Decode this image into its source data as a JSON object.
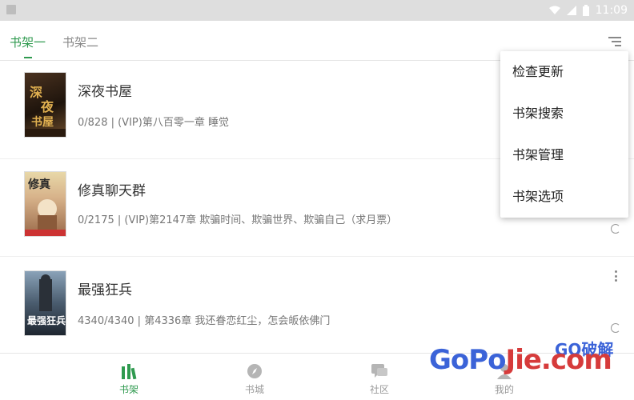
{
  "status_bar": {
    "time": "11:09"
  },
  "tabs": [
    {
      "label": "书架一",
      "active": true
    },
    {
      "label": "书架二",
      "active": false
    }
  ],
  "books": [
    {
      "title": "深夜书屋",
      "meta": "0/828 | (VIP)第八百零一章 睡觉"
    },
    {
      "title": "修真聊天群",
      "meta": "0/2175 | (VIP)第2147章 欺骗时间、欺骗世界、欺骗自己（求月票）"
    },
    {
      "title": "最强狂兵",
      "meta": "4340/4340 | 第4336章 我还眷恋红尘，怎会皈依佛门"
    }
  ],
  "popup_menu": {
    "items": [
      "检查更新",
      "书架搜索",
      "书架管理",
      "书架选项"
    ]
  },
  "bottom_nav": [
    {
      "label": "书架",
      "icon": "bookshelf-icon",
      "active": true
    },
    {
      "label": "书城",
      "icon": "compass-icon",
      "active": false
    },
    {
      "label": "社区",
      "icon": "chat-icon",
      "active": false
    },
    {
      "label": "我的",
      "icon": "profile-icon",
      "active": false
    }
  ],
  "watermark": {
    "text_blue": "GoPo",
    "text_red": "Jie",
    "suffix": ".com",
    "small": "GO破解"
  },
  "colors": {
    "accent": "#2f9a4f",
    "text": "#333333",
    "muted": "#777777"
  }
}
